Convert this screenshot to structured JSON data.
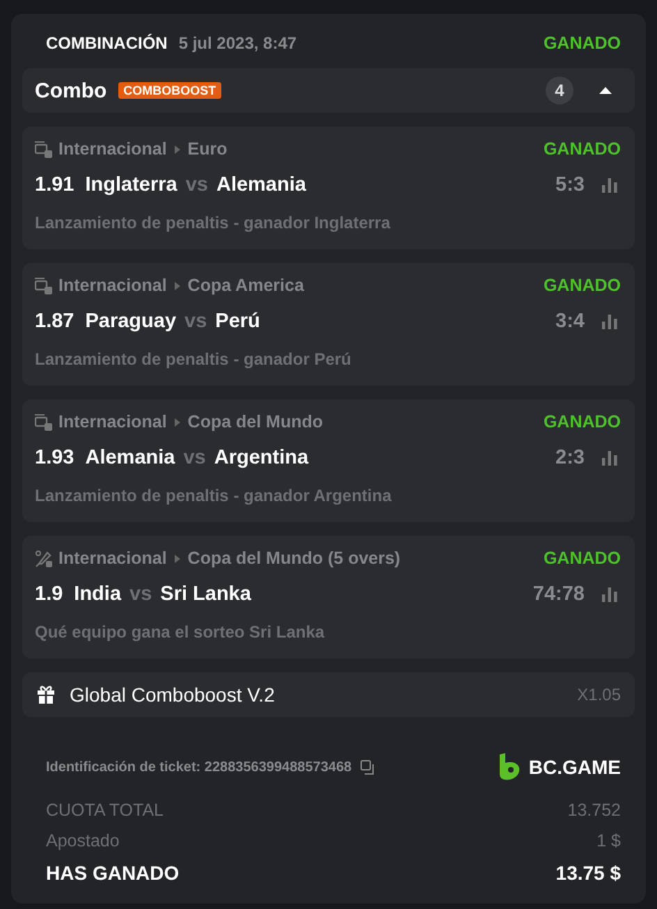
{
  "header": {
    "title": "COMBINACIÓN",
    "date": "5 jul 2023, 8:47",
    "status": "GANADO"
  },
  "combo": {
    "label": "Combo",
    "badge": "COMBOBOOST",
    "count": "4",
    "expanded": true
  },
  "legs": [
    {
      "kind": "fifa",
      "category": "Internacional",
      "league": "Euro",
      "status": "GANADO",
      "odds": "1.91",
      "home": "Inglaterra",
      "vs": "vs",
      "away": "Alemania",
      "score": "5:3",
      "market": "Lanzamiento de penaltis - ganador Inglaterra"
    },
    {
      "kind": "fifa",
      "category": "Internacional",
      "league": "Copa America",
      "status": "GANADO",
      "odds": "1.87",
      "home": "Paraguay",
      "vs": "vs",
      "away": "Perú",
      "score": "3:4",
      "market": "Lanzamiento de penaltis - ganador Perú"
    },
    {
      "kind": "fifa",
      "category": "Internacional",
      "league": "Copa del Mundo",
      "status": "GANADO",
      "odds": "1.93",
      "home": "Alemania",
      "vs": "vs",
      "away": "Argentina",
      "score": "2:3",
      "market": "Lanzamiento de penaltis - ganador Argentina"
    },
    {
      "kind": "cricket",
      "category": "Internacional",
      "league": "Copa del Mundo (5 overs)",
      "status": "GANADO",
      "odds": "1.9",
      "home": "India",
      "vs": "vs",
      "away": "Sri Lanka",
      "score": "74:78",
      "market": "Qué equipo gana el sorteo Sri Lanka"
    }
  ],
  "boost": {
    "label": "Global Comboboost V.2",
    "multiplier": "X1.05"
  },
  "ticket": {
    "label": "Identificación de ticket: 2288356399488573468",
    "brand": "BC.GAME"
  },
  "totals": [
    {
      "kind": "muted",
      "label": "CUOTA TOTAL",
      "value": "13.752"
    },
    {
      "kind": "muted",
      "label": "Apostado",
      "value": "1 $"
    },
    {
      "kind": "strong",
      "label": "HAS GANADO",
      "value": "13.75 $"
    }
  ]
}
